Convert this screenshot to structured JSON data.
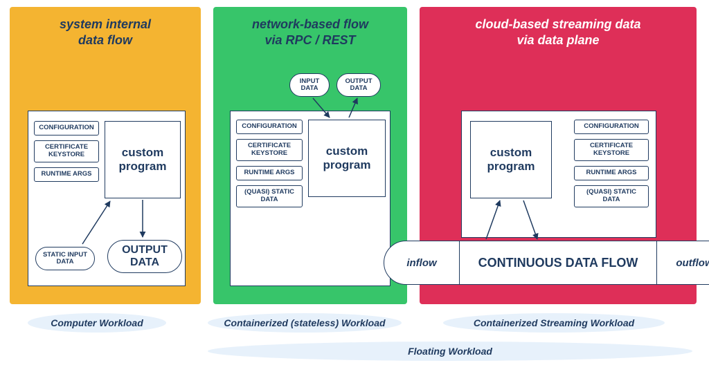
{
  "panels": {
    "yellow": {
      "title_l1": "system internal",
      "title_l2": "data flow",
      "chips": {
        "c1": "CONFIGURATION",
        "c2": "CERTIFICATE KEYSTORE",
        "c3": "RUNTIME ARGS"
      },
      "program": "custom program",
      "static_input": "STATIC INPUT DATA",
      "output": "OUTPUT DATA"
    },
    "green": {
      "title_l1": "network-based flow",
      "title_l2": "via RPC / REST",
      "chips": {
        "c1": "CONFIGURATION",
        "c2": "CERTIFICATE KEYSTORE",
        "c3": "RUNTIME ARGS",
        "c4": "(QUASI) STATIC DATA"
      },
      "program": "custom program",
      "input": "INPUT DATA",
      "output": "OUTPUT DATA"
    },
    "red": {
      "title_l1": "cloud-based streaming data",
      "title_l2": "via data plane",
      "chips": {
        "c1": "CONFIGURATION",
        "c2": "CERTIFICATE KEYSTORE",
        "c3": "RUNTIME ARGS",
        "c4": "(QUASI) STATIC DATA"
      },
      "program": "custom program",
      "inflow": "inflow",
      "continuous": "CONTINUOUS DATA FLOW",
      "outflow": "outflow"
    }
  },
  "labels": {
    "l1": "Computer Workload",
    "l2": "Containerized (stateless) Workload",
    "l3": "Containerized Streaming Workload",
    "l4": "Floating Workload"
  }
}
